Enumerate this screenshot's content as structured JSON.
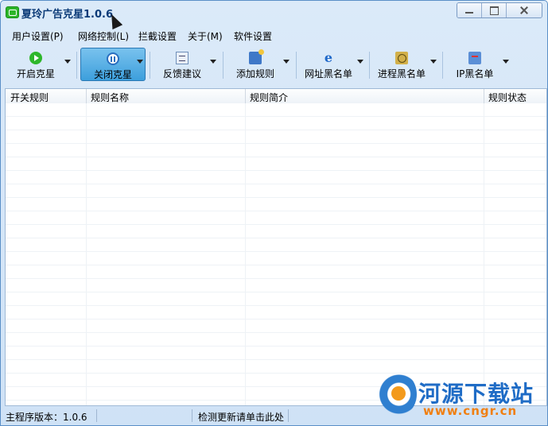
{
  "window": {
    "title": "夏玲广告克星1.0.6",
    "colors": {
      "accent": "#3d9fdc",
      "frame": "#cfe2f6"
    }
  },
  "menu": {
    "items": [
      {
        "label": "用户设置(P)"
      },
      {
        "label": "网络控制(L)"
      },
      {
        "label": "拦截设置"
      },
      {
        "label": "关于(M)"
      },
      {
        "label": "软件设置"
      }
    ]
  },
  "toolbar": {
    "buttons": [
      {
        "label": "开启克星",
        "icon": "play-icon"
      },
      {
        "label": "关闭克星",
        "icon": "pause-icon",
        "active": true
      },
      {
        "label": "反馈建议",
        "icon": "feedback-icon"
      },
      {
        "label": "添加规则",
        "icon": "add-rule-icon"
      },
      {
        "label": "网址黑名单",
        "icon": "ie-icon"
      },
      {
        "label": "进程黑名单",
        "icon": "process-icon"
      },
      {
        "label": "IP黑名单",
        "icon": "ip-icon"
      }
    ],
    "ie_glyph": "e"
  },
  "table": {
    "columns": [
      "开关规则",
      "规则名称",
      "规则简介",
      "规则状态"
    ],
    "rows": []
  },
  "status": {
    "version": "主程序版本：1.0.6",
    "update": "检测更新请单击此处"
  },
  "watermark": {
    "title": "河源下载站",
    "url": "www.cngr.cn"
  }
}
